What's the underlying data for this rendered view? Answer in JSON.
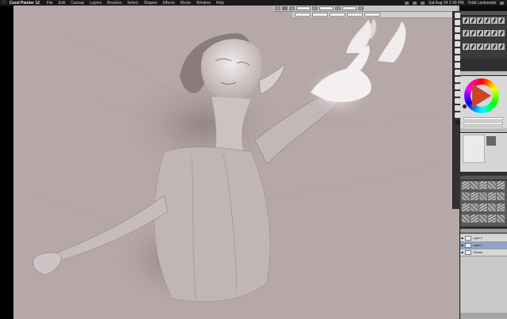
{
  "menubar": {
    "app_name": "Corel Painter 12",
    "items": [
      "File",
      "Edit",
      "Canvas",
      "Layers",
      "Brushes",
      "Select",
      "Shapes",
      "Effects",
      "Movie",
      "Window",
      "Help"
    ],
    "datetime": "Sat Aug 24  2:30 PM",
    "user": "Todd Lankowski"
  },
  "layers": {
    "rows": [
      "Layer 2",
      "Layer 1",
      "Canvas"
    ],
    "active_index": 1
  },
  "colors": {
    "accent": "#c44422",
    "canvas_bg": "#b6a8a9"
  },
  "icons": {
    "apple": "apple-icon",
    "brush": "brush-icon",
    "eye": "eye-icon"
  }
}
